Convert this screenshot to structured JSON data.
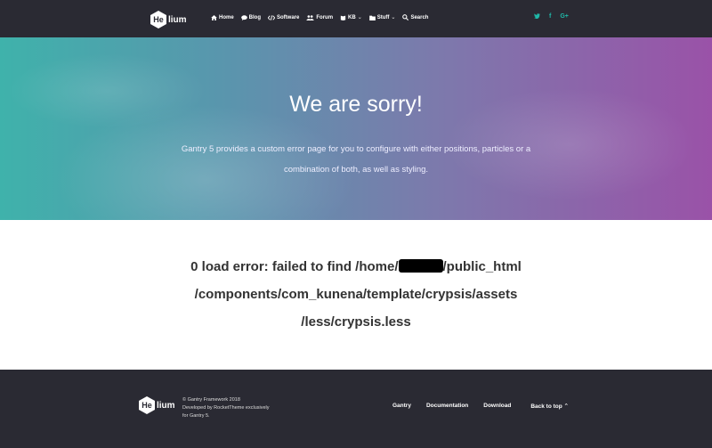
{
  "header": {
    "logo": {
      "mark": "He",
      "rest": "lium"
    },
    "nav": [
      {
        "label": "Home",
        "icon": "home-icon"
      },
      {
        "label": "Blog",
        "icon": "comment-icon"
      },
      {
        "label": "Software",
        "icon": "code-icon"
      },
      {
        "label": "Forum",
        "icon": "users-icon"
      },
      {
        "label": "KB",
        "icon": "book-icon",
        "dropdown": true
      },
      {
        "label": "Stuff",
        "icon": "folder-icon",
        "dropdown": true
      },
      {
        "label": "Search",
        "icon": "search-icon"
      }
    ],
    "social": [
      {
        "glyph": "•",
        "icon": "twitter-icon"
      },
      {
        "glyph": "f",
        "icon": "facebook-icon"
      },
      {
        "glyph": "G+",
        "icon": "google-plus-icon"
      }
    ]
  },
  "hero": {
    "title": "We are sorry!",
    "text": "Gantry 5 provides a custom error page for you to configure with either positions, particles or a combination of both, as well as styling."
  },
  "error": {
    "line1_before": "0 load error: failed to find /home/",
    "line1_after": "/public_html",
    "line2": "/components/com_kunena/template/crypsis/assets",
    "line3": "/less/crypsis.less"
  },
  "footer": {
    "logo": {
      "mark": "He",
      "rest": "lium"
    },
    "copyright": [
      "© Gantry Framework 2018",
      "Developed by RocketTheme exclusively",
      "for Gantry 5."
    ],
    "links": [
      "Gantry",
      "Documentation",
      "Download"
    ],
    "back_to_top": "Back to top ⌃"
  },
  "colors": {
    "header_bg": "#2a2a33",
    "accent_teal": "#1fb8a8",
    "gradient_start": "#3fb2ab",
    "gradient_end": "#9a52a8"
  }
}
